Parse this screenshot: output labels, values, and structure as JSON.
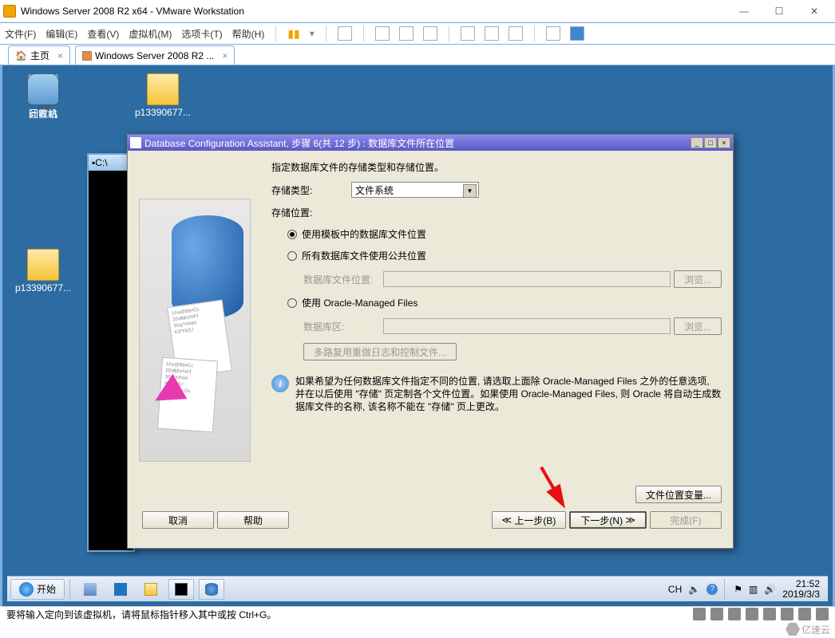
{
  "vmware": {
    "title": "Windows Server 2008 R2 x64 - VMware Workstation",
    "menus": [
      "文件(F)",
      "编辑(E)",
      "查看(V)",
      "虚拟机(M)",
      "选项卡(T)",
      "帮助(H)"
    ],
    "tabs": {
      "home": "主页",
      "vm": "Windows Server 2008 R2 ..."
    },
    "status": "要将输入定向到该虚拟机，请将鼠标指针移入其中或按 Ctrl+G。"
  },
  "desktop": {
    "computer": "计算机",
    "recycle": "回收站",
    "folder1": "p13390677...",
    "folder2": "p13390677..."
  },
  "cmd": {
    "title": "C:\\"
  },
  "dbca": {
    "title": "Database Configuration Assistant, 步骤 6(共 12 步) : 数据库文件所在位置",
    "intro": "指定数据库文件的存储类型和存储位置。",
    "storage_type_label": "存储类型:",
    "storage_type_value": "文件系统",
    "storage_loc_label": "存储位置:",
    "opt_template": "使用模板中的数据库文件位置",
    "opt_common": "所有数据库文件使用公共位置",
    "db_file_loc_label": "数据库文件位置:",
    "browse1": "浏览...",
    "opt_omf": "使用 Oracle-Managed Files",
    "db_area_label": "数据库区:",
    "browse2": "浏览...",
    "multiplex": "多路复用重做日志和控制文件...",
    "info": "如果希望为任何数据库文件指定不同的位置, 请选取上面除 Oracle-Managed Files 之外的任意选项, 并在以后使用 \"存储\" 页定制各个文件位置。如果使用 Oracle-Managed Files, 则 Oracle 将自动生成数据库文件的名称, 该名称不能在 \"存储\" 页上更改。",
    "file_loc_vars": "文件位置变量...",
    "btn_cancel": "取消",
    "btn_help": "帮助",
    "btn_back": "上一步(B)",
    "btn_next": "下一步(N)",
    "btn_finish": "完成(F)"
  },
  "taskbar": {
    "start": "开始",
    "ime": "CH",
    "time": "21:52",
    "date": "2019/3/3"
  },
  "watermark": "亿速云"
}
